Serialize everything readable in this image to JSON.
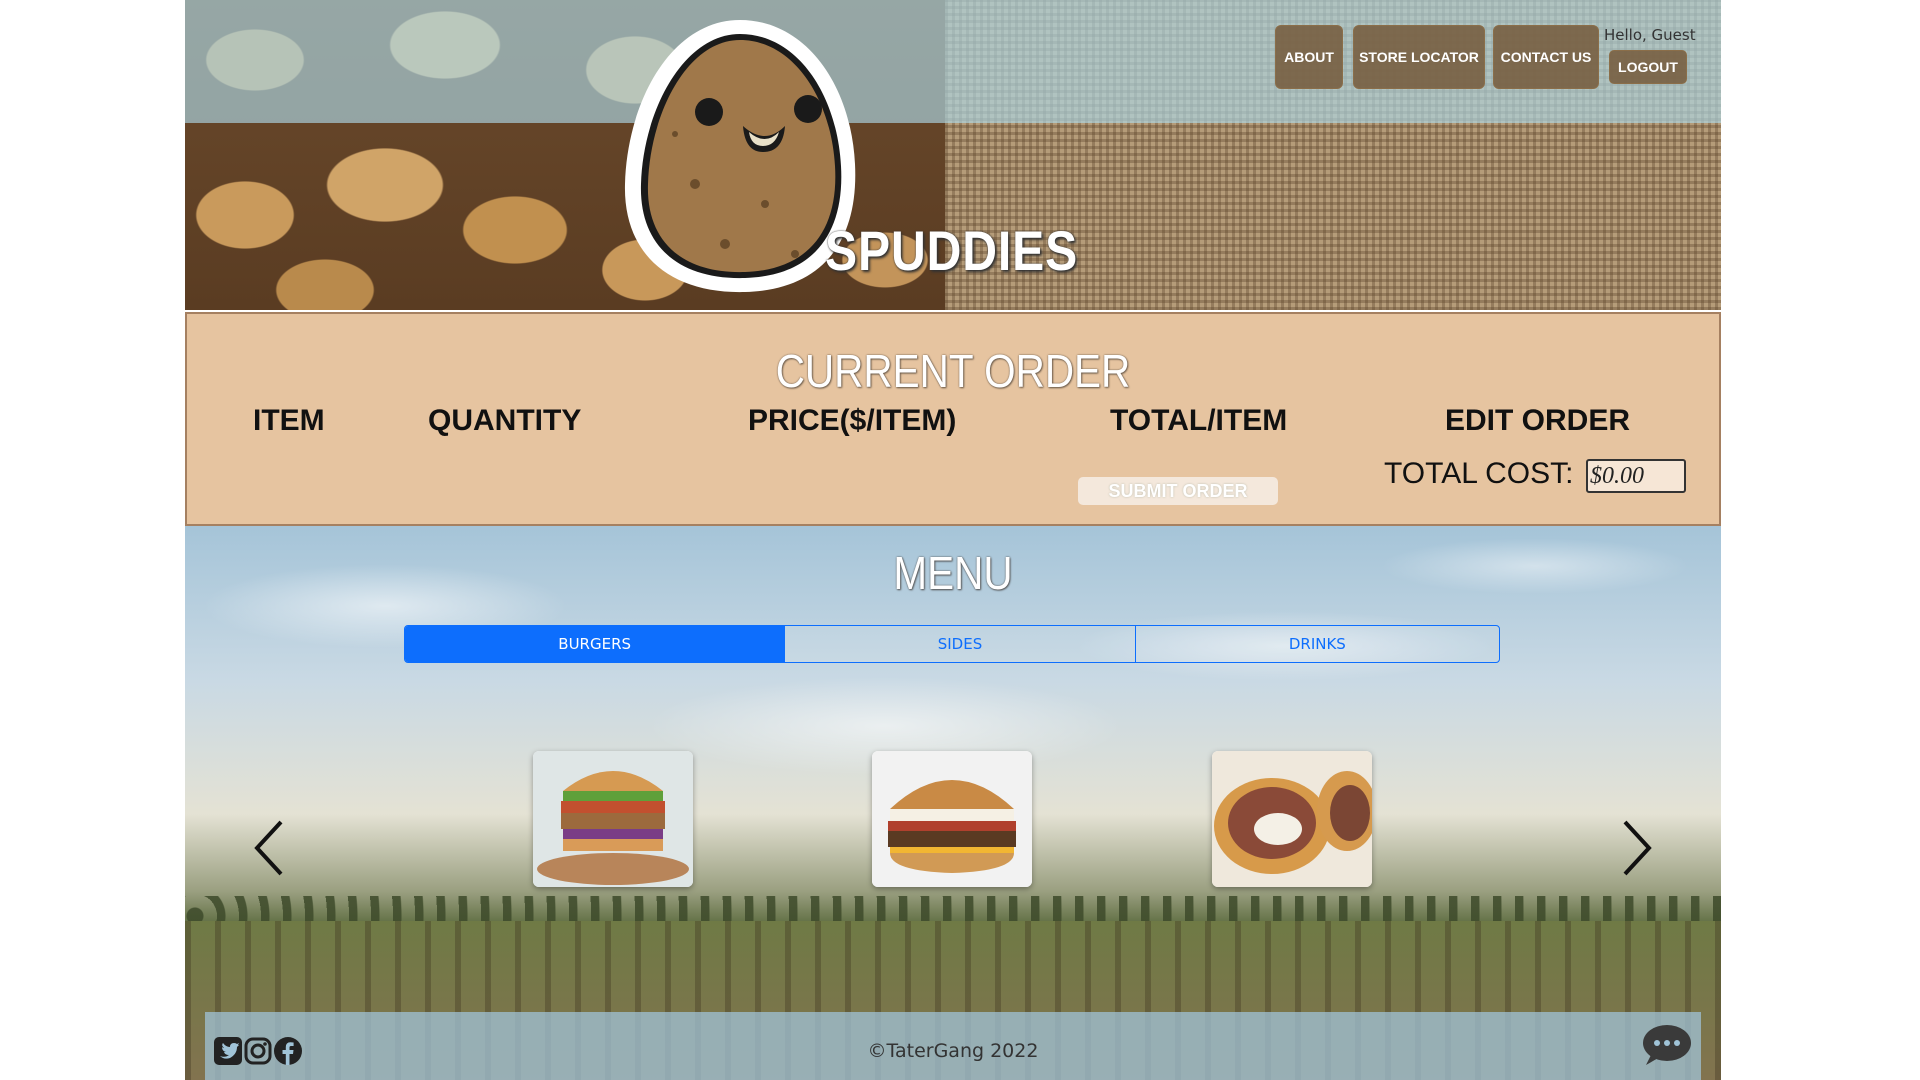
{
  "header": {
    "brand": "SPUDDIES",
    "nav": [
      {
        "label": "ABOUT"
      },
      {
        "label": "STORE LOCATOR"
      },
      {
        "label": "CONTACT US"
      }
    ],
    "greeting": "Hello, Guest",
    "logout_label": "LOGOUT"
  },
  "order": {
    "title": "CURRENT ORDER",
    "columns": [
      "ITEM",
      "QUANTITY",
      "PRICE($/ITEM)",
      "TOTAL/ITEM",
      "EDIT ORDER"
    ],
    "submit_label": "SUBMIT ORDER",
    "total_label": "TOTAL COST:",
    "total_value": "$0.00"
  },
  "menu": {
    "title": "MENU",
    "tabs": [
      {
        "label": "BURGERS",
        "active": true
      },
      {
        "label": "SIDES",
        "active": false
      },
      {
        "label": "DRINKS",
        "active": false
      }
    ],
    "icons": {
      "prev": "chevron-left-icon",
      "next": "chevron-right-icon"
    }
  },
  "footer": {
    "copyright": "©TaterGang 2022",
    "social": [
      "twitter-icon",
      "instagram-icon",
      "facebook-icon"
    ],
    "chat_icon": "chat-bubble-icon"
  },
  "colors": {
    "accent": "#0d6efd",
    "nav_button": "#785f41",
    "order_panel": "#e6c4a0"
  }
}
